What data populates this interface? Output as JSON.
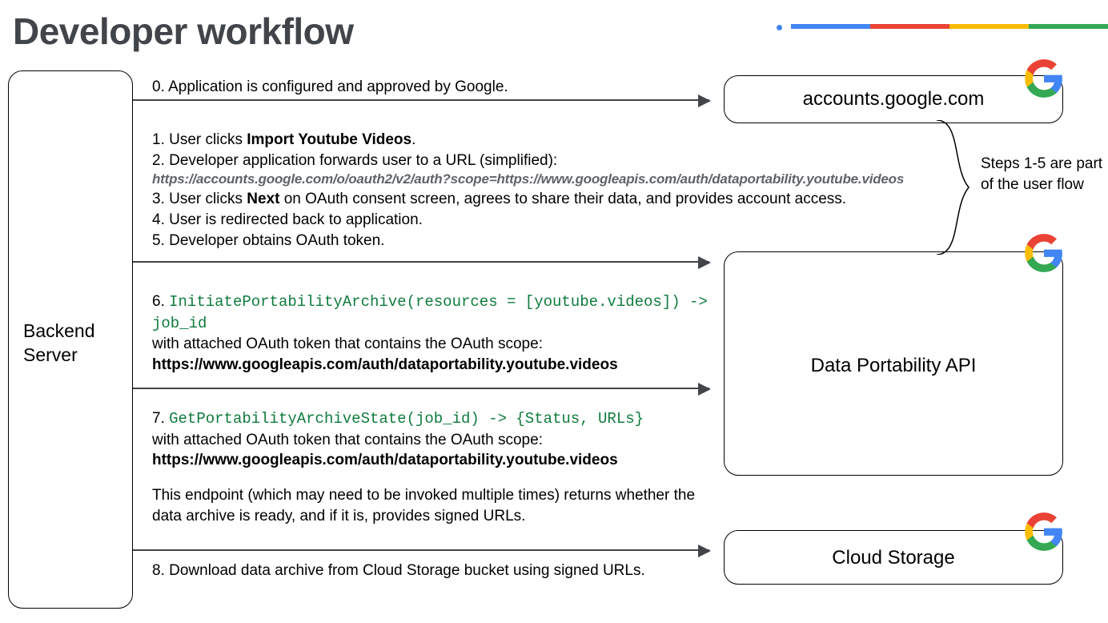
{
  "title": "Developer workflow",
  "bar_colors": [
    "#4285F4",
    "#EA4335",
    "#FBBC04",
    "#34A853"
  ],
  "nodes": {
    "backend": "Backend Server",
    "accounts": "accounts.google.com",
    "dpa": "Data Portability API",
    "cloud": "Cloud Storage"
  },
  "step0": "0. Application is configured and approved by Google.",
  "step1_a": "1. User clicks ",
  "step1_b": "Import Youtube Videos",
  "step1_c": ".",
  "step2": "2. Developer application forwards user to a URL (simplified):",
  "step2_url": "https://accounts.google.com/o/oauth2/v2/auth?scope=https://www.googleapis.com/auth/dataportability.youtube.videos",
  "step3_a": "3. User clicks ",
  "step3_b": "Next",
  "step3_c": " on OAuth consent screen, agrees to share their data, and provides account access.",
  "step4": "4. User is redirected back to application.",
  "step5": "5. Developer obtains OAuth token.",
  "step6_num": "6. ",
  "step6_code": "InitiatePortabilityArchive(resources = [youtube.videos]) -> job_id",
  "step6_desc": "with attached OAuth token that contains the OAuth scope:",
  "step6_url": "https://www.googleapis.com/auth/dataportability.youtube.videos",
  "step7_num": "7. ",
  "step7_code": "GetPortabilityArchiveState(job_id) -> {Status, URLs}",
  "step7_desc": "with attached OAuth token that contains the OAuth scope:",
  "step7_url": "https://www.googleapis.com/auth/dataportability.youtube.videos",
  "step7_note": "This endpoint (which may need to be invoked multiple times) returns whether the data archive is ready, and if it is, provides signed URLs.",
  "step8": "8. Download data archive from Cloud Storage bucket using signed URLs.",
  "brace_note": "Steps 1-5 are part of the user flow"
}
